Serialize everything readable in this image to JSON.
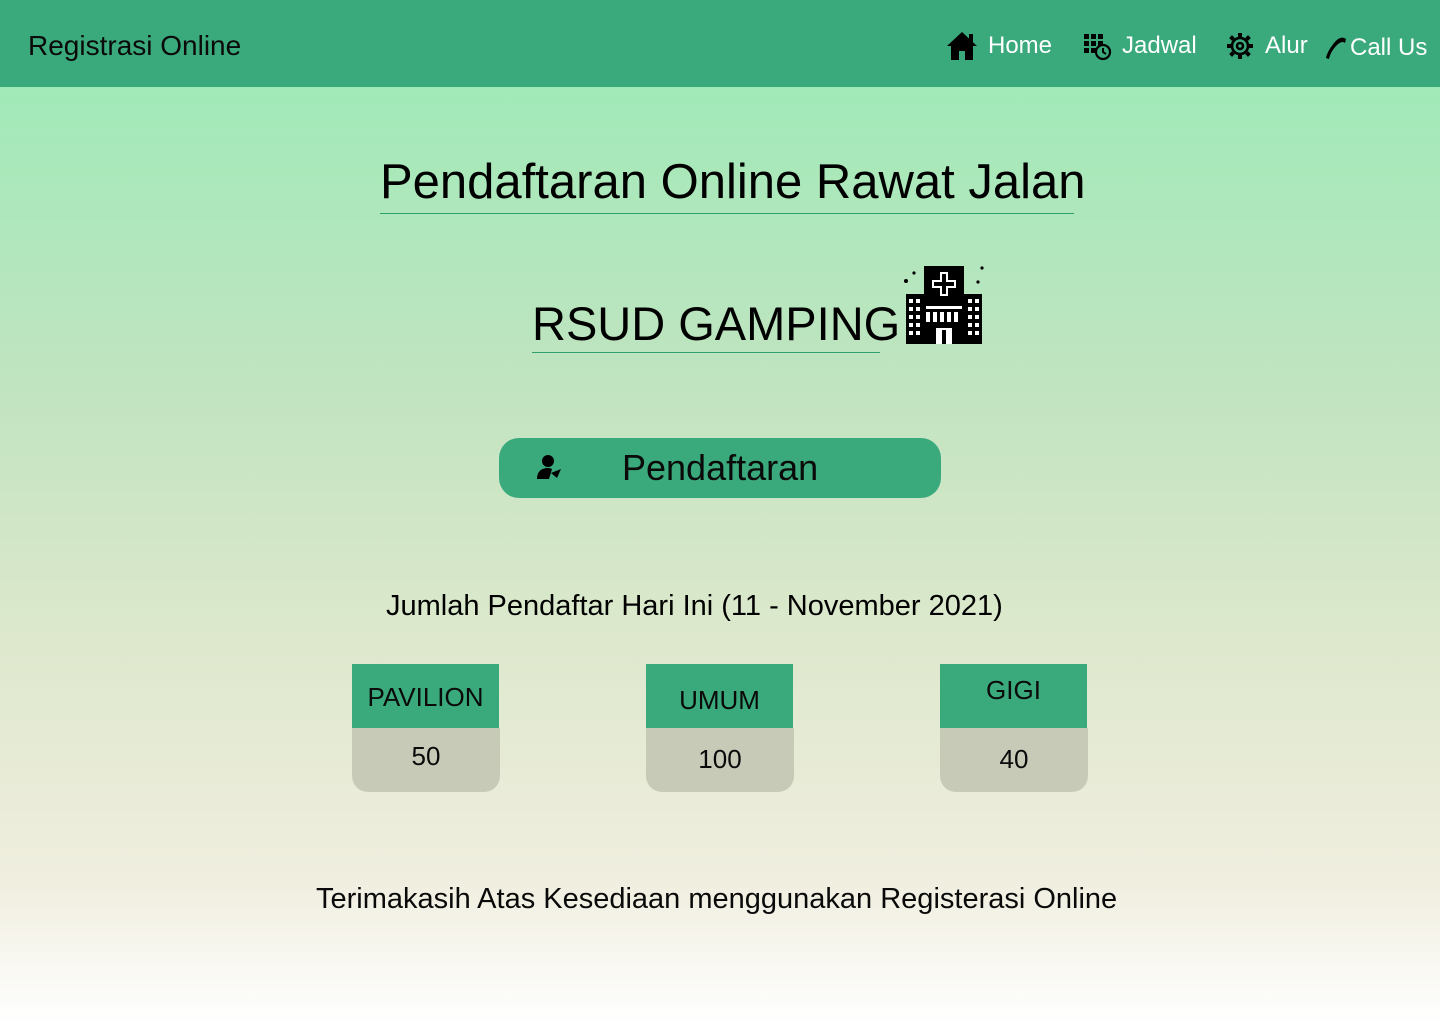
{
  "navbar": {
    "brand": "Registrasi Online",
    "items": [
      {
        "label": "Home",
        "icon": "home-icon"
      },
      {
        "label": "Jadwal",
        "icon": "calendar-clock-icon"
      },
      {
        "label": "Alur",
        "icon": "gear-icon"
      },
      {
        "label": "Call Us",
        "icon": "phone-icon"
      }
    ]
  },
  "main": {
    "title": "Pendaftaran Online Rawat Jalan",
    "hospital_name": "RSUD GAMPING",
    "hospital_icon": "hospital-building-icon",
    "register_button": {
      "label": "Pendaftaran",
      "icon": "user-register-icon"
    },
    "count_heading": "Jumlah Pendaftar Hari Ini (11 - November 2021)",
    "stats": [
      {
        "label": "PAVILION",
        "value": "50"
      },
      {
        "label": "UMUM",
        "value": "100"
      },
      {
        "label": "GIGI",
        "value": "40"
      }
    ],
    "footer_text": "Terimakasih Atas Kesediaan menggunakan Registerasi Online"
  },
  "colors": {
    "navbar": "#3aaa7c",
    "button": "#3aaa7c",
    "stat_value_bg": "#c8cab8",
    "gradient_top": "#98ebb6",
    "gradient_bottom": "#ffffff"
  }
}
